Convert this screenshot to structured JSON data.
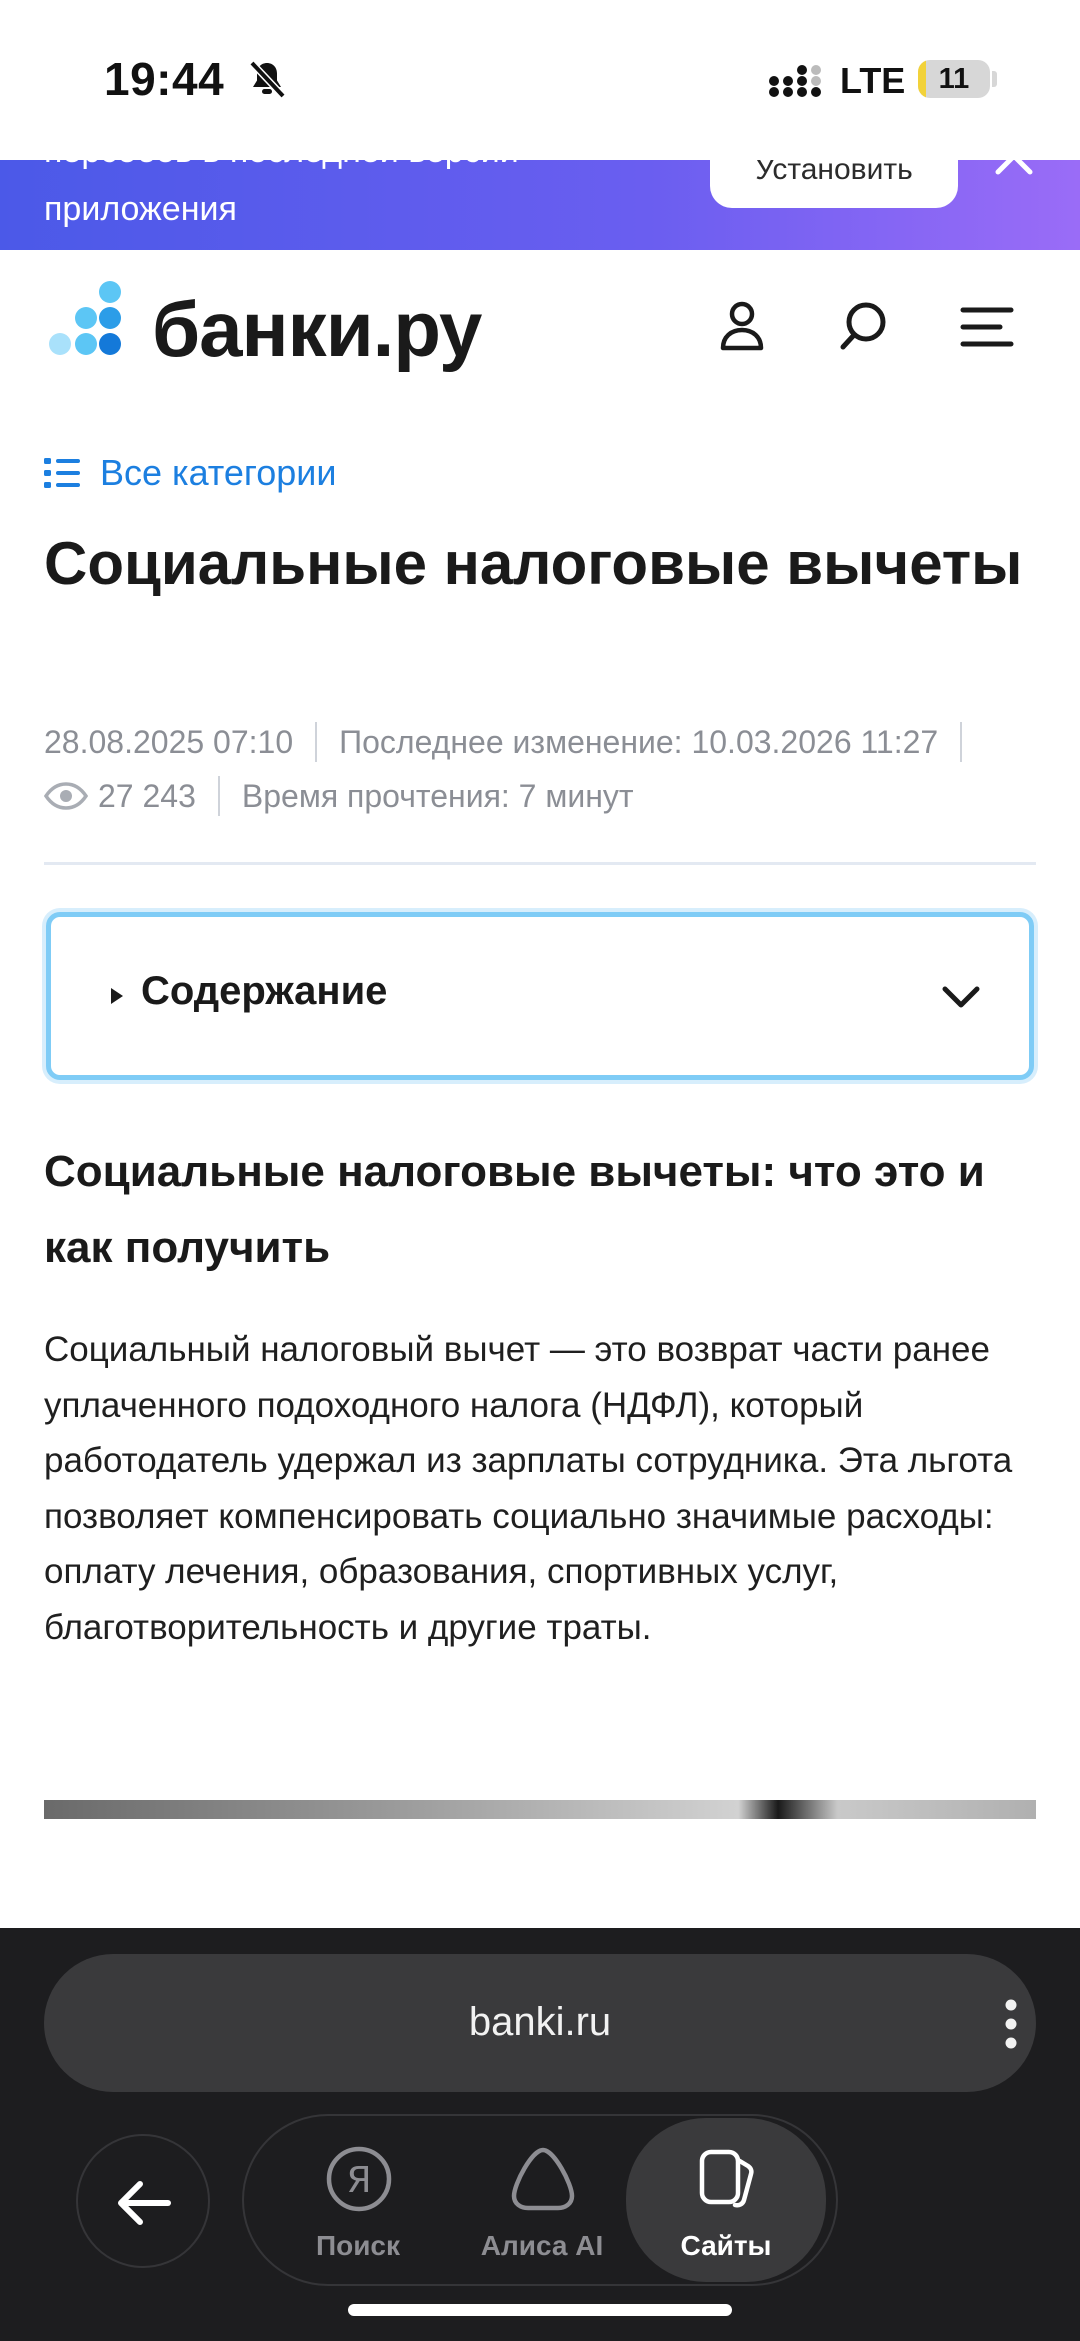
{
  "status_bar": {
    "time": "19:44",
    "network": "LTE",
    "battery_level": "11",
    "battery_fraction": 0.11
  },
  "banner": {
    "text_top": "персобов в последней версии",
    "text": "приложения",
    "button_label": "Установить"
  },
  "header": {
    "logo_text": "банки.ру"
  },
  "article": {
    "categories_label": "Все категории",
    "title": "Социальные налоговые вычеты",
    "published": "28.08.2025 07:10",
    "modified": "Последнее изменение: 10.03.2026 11:27",
    "views": "27 243",
    "read_time": "Время прочтения: 7 минут",
    "toc_label": "Содержание",
    "section_heading": "Социальные налоговые вычеты: что это и как получить",
    "body": "Социальный налоговый вычет — это возврат части ранее уплаченного подоходного налога (НДФЛ), который работодатель удержал из зарплаты сотрудника. Эта льгота позволяет компенсировать социально значимые расходы: оплату лечения, образования, спортивных услуг, благотворительность и другие траты."
  },
  "browser": {
    "url": "banki.ru",
    "nav": [
      {
        "label": "Поиск",
        "icon": "yandex-icon"
      },
      {
        "label": "Алиса AI",
        "icon": "alice-icon"
      },
      {
        "label": "Сайты",
        "icon": "sites-icon",
        "active": true
      }
    ]
  },
  "colors": {
    "accent_blue": "#1c7fe0",
    "banner_start": "#4b59e8",
    "banner_end": "#9a6cf7",
    "toc_border": "#7fccf6",
    "browser_bg": "#1d1d1f"
  }
}
